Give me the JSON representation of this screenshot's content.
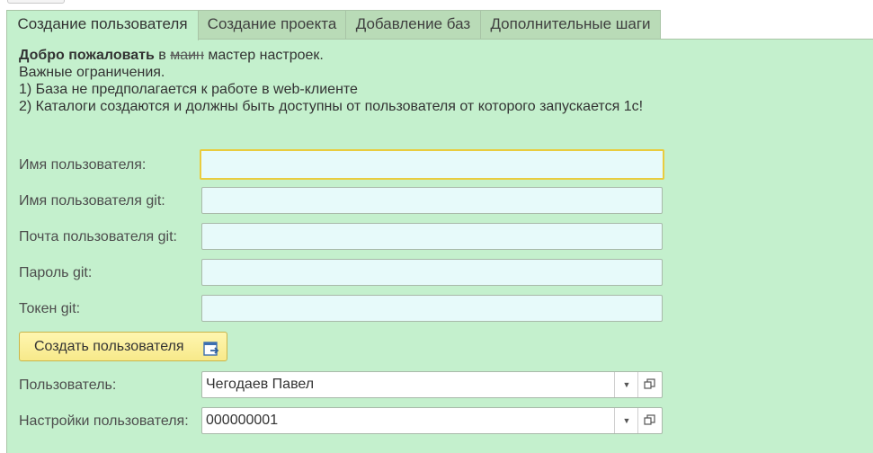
{
  "tabs": [
    {
      "label": "Создание пользователя",
      "active": true
    },
    {
      "label": "Создание проекта",
      "active": false
    },
    {
      "label": "Добавление баз",
      "active": false
    },
    {
      "label": "Дополнительные шаги",
      "active": false
    }
  ],
  "intro": {
    "welcome_bold": "Добро пожаловать",
    "welcome_in": " в ",
    "welcome_strike": "маин",
    "welcome_rest": " мастер настроек.",
    "line2": "Важные ограничения.",
    "line3": "1) База не предполагается к работе в web-клиенте",
    "line4": "2) Каталоги создаются и должны быть доступны от пользователя от которого запускается 1с!"
  },
  "form": {
    "username_label": "Имя пользователя:",
    "username_value": "",
    "git_username_label": "Имя пользователя git:",
    "git_username_value": "",
    "git_email_label": "Почта пользователя git:",
    "git_email_value": "",
    "git_password_label": "Пароль git:",
    "git_password_value": "",
    "git_token_label": "Токен git:",
    "git_token_value": "",
    "create_user_button": "Создать пользователя",
    "user_label": "Пользователь:",
    "user_value": "Чегодаев Павел",
    "user_settings_label": "Настройки пользователя:",
    "user_settings_value": "000000001"
  },
  "icons": {
    "create_user_button_icon": "open-form-arrow-icon",
    "dropdown": "chevron-down-icon",
    "open": "open-in-window-icon"
  },
  "colors": {
    "panel_bg": "#c4f0cd",
    "tab_inactive_bg": "#b9dbb7",
    "input_bg": "#e7fafa",
    "focus_border": "#e9cc3f",
    "button_bg": "#f7e98a"
  }
}
